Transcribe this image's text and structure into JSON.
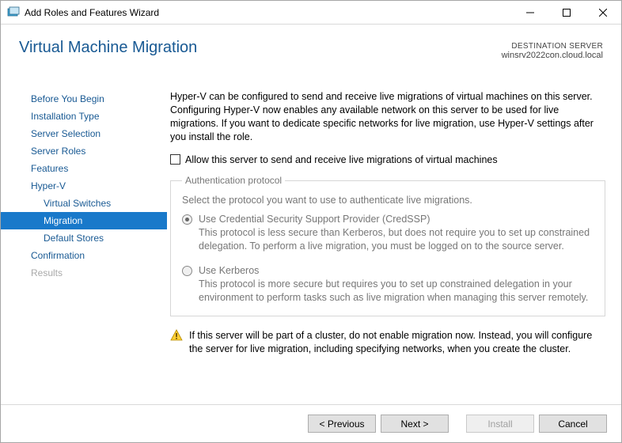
{
  "window": {
    "title": "Add Roles and Features Wizard"
  },
  "header": {
    "page_title": "Virtual Machine Migration",
    "destination_label": "DESTINATION SERVER",
    "destination_value": "winsrv2022con.cloud.local"
  },
  "nav": {
    "items": [
      {
        "label": "Before You Begin",
        "disabled": false
      },
      {
        "label": "Installation Type",
        "disabled": false
      },
      {
        "label": "Server Selection",
        "disabled": false
      },
      {
        "label": "Server Roles",
        "disabled": false
      },
      {
        "label": "Features",
        "disabled": false
      },
      {
        "label": "Hyper-V",
        "disabled": false
      },
      {
        "label": "Virtual Switches",
        "disabled": false,
        "sub": true
      },
      {
        "label": "Migration",
        "disabled": false,
        "sub": true,
        "selected": true
      },
      {
        "label": "Default Stores",
        "disabled": false,
        "sub": true
      },
      {
        "label": "Confirmation",
        "disabled": false
      },
      {
        "label": "Results",
        "disabled": true
      }
    ]
  },
  "content": {
    "intro": "Hyper-V can be configured to send and receive live migrations of virtual machines on this server. Configuring Hyper-V now enables any available network on this server to be used for live migrations. If you want to dedicate specific networks for live migration, use Hyper-V settings after you install the role.",
    "allow_checkbox_label": "Allow this server to send and receive live migrations of virtual machines",
    "allow_checkbox_checked": false,
    "auth": {
      "legend": "Authentication protocol",
      "hint": "Select the protocol you want to use to authenticate live migrations.",
      "options": [
        {
          "label": "Use Credential Security Support Provider (CredSSP)",
          "desc": "This protocol is less secure than Kerberos, but does not require you to set up constrained delegation. To perform a live migration, you must be logged on to the source server.",
          "checked": true
        },
        {
          "label": "Use Kerberos",
          "desc": "This protocol is more secure but requires you to set up constrained delegation in your environment to perform tasks such as live migration when managing this server remotely.",
          "checked": false
        }
      ]
    },
    "warning": "If this server will be part of a cluster, do not enable migration now. Instead, you will configure the server for live migration, including specifying networks, when you create the cluster."
  },
  "footer": {
    "previous": "< Previous",
    "next": "Next >",
    "install": "Install",
    "cancel": "Cancel"
  }
}
